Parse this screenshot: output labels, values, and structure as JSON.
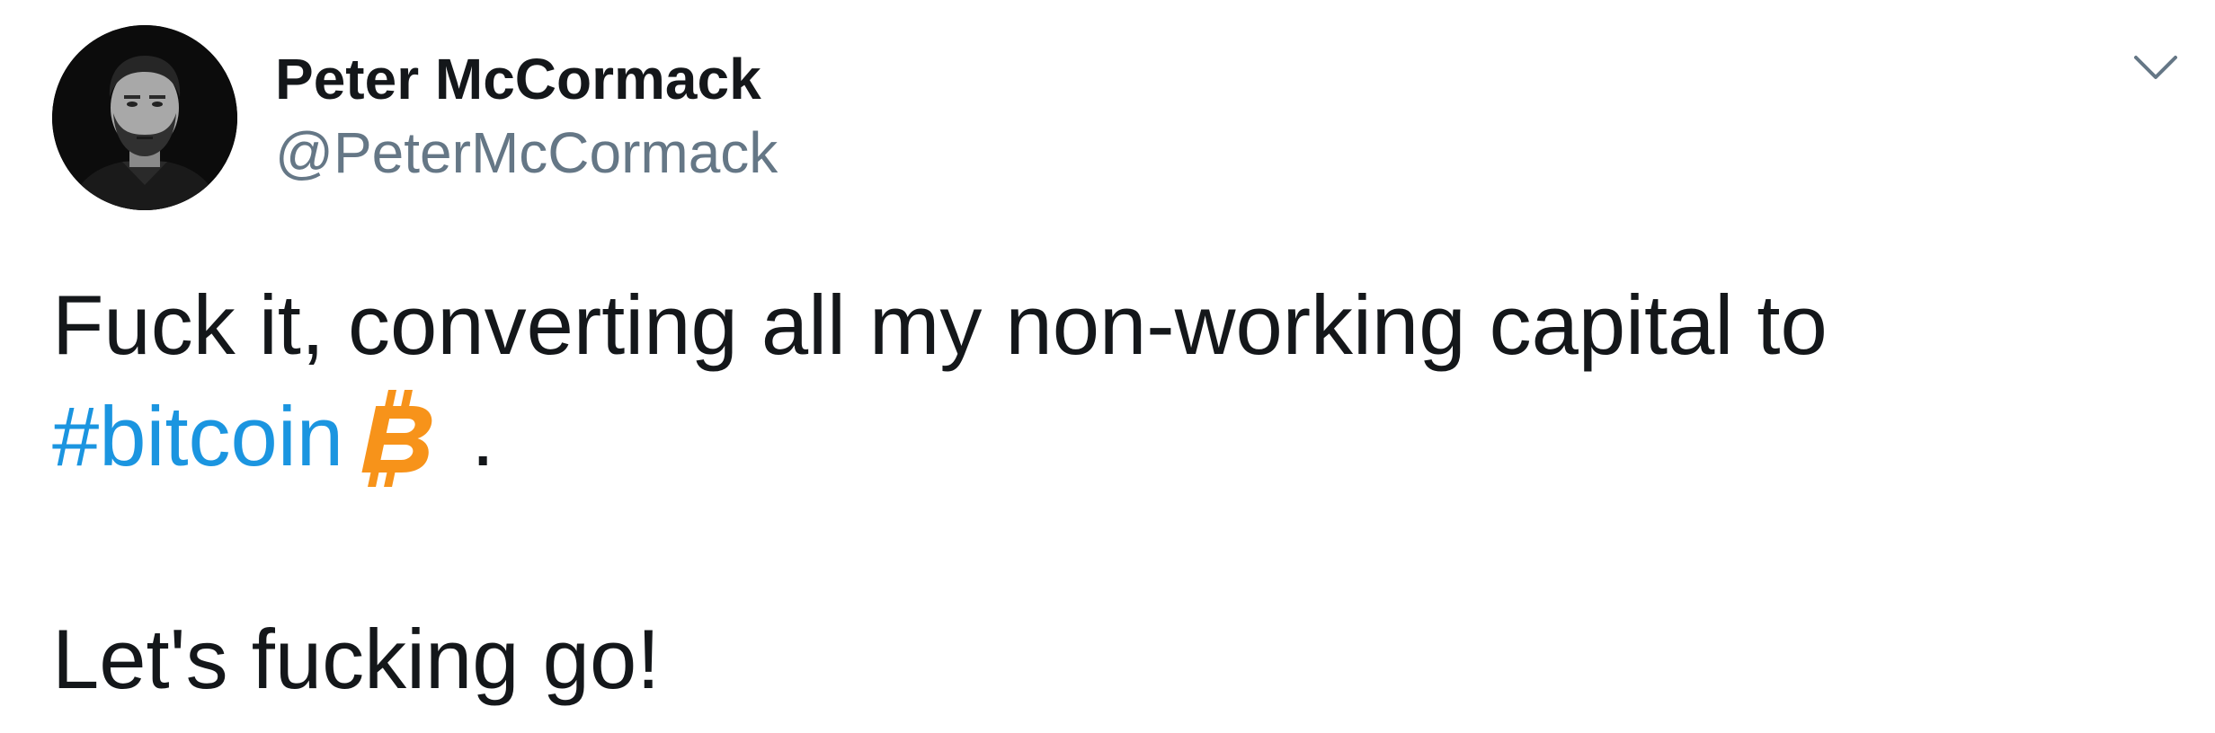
{
  "user": {
    "display_name": "Peter McCormack",
    "handle": "@PeterMcCormack"
  },
  "tweet": {
    "line1": "Fuck it, converting all my non-working capital to",
    "hashtag": "#bitcoin",
    "after_hashtag": " .",
    "line3": "Let's fucking go!"
  },
  "icons": {
    "caret": "chevron-down-icon",
    "hashtag_emoji": "bitcoin-icon"
  },
  "colors": {
    "text": "#14171a",
    "secondary": "#657786",
    "link": "#1b95e0",
    "bitcoin": "#f7931a"
  }
}
